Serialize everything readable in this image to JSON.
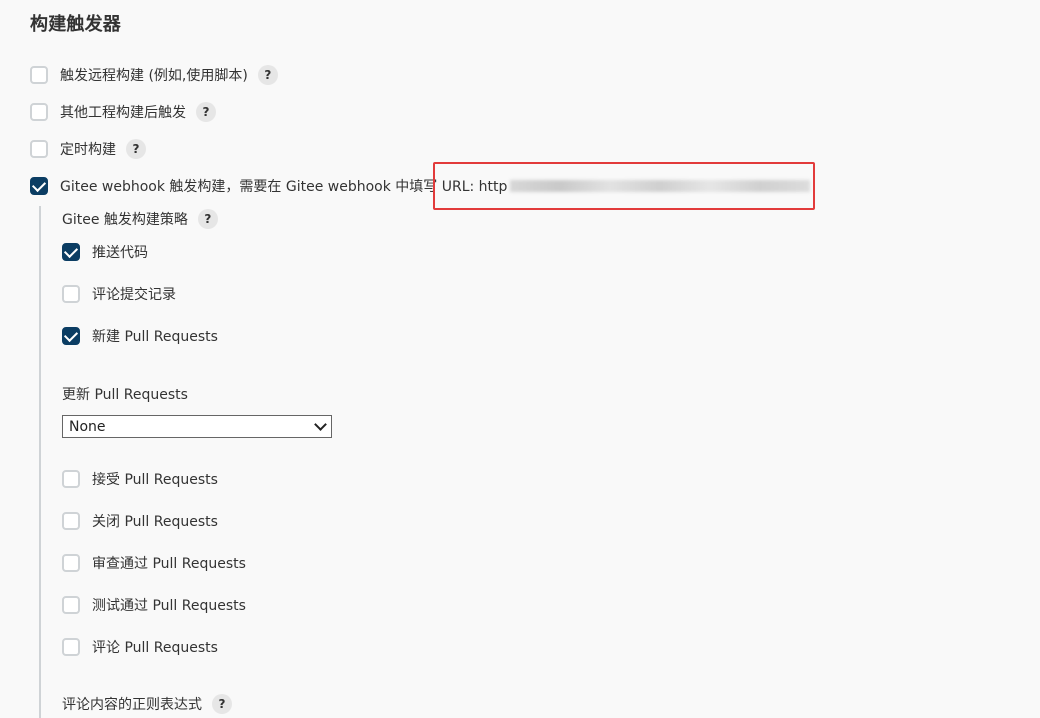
{
  "section": {
    "title": "构建触发器"
  },
  "triggers": [
    {
      "label": "触发远程构建 (例如,使用脚本)",
      "checked": false,
      "help": "?"
    },
    {
      "label": "其他工程构建后触发",
      "checked": false,
      "help": "?"
    },
    {
      "label": "定时构建",
      "checked": false,
      "help": "?"
    },
    {
      "label": "Gitee webhook 触发构建，需要在 Gitee webhook 中填写 URL: http",
      "checked": true
    }
  ],
  "gitee": {
    "strategy_title": "Gitee 触发构建策略",
    "strategy_help": "?",
    "strategies": [
      {
        "label": "推送代码",
        "checked": true
      },
      {
        "label": "评论提交记录",
        "checked": false
      },
      {
        "label": "新建 Pull Requests",
        "checked": true
      }
    ],
    "update_pr_label": "更新 Pull Requests",
    "update_pr_select_value": "None",
    "pr_actions": [
      {
        "label": "接受 Pull Requests",
        "checked": false
      },
      {
        "label": "关闭 Pull Requests",
        "checked": false
      },
      {
        "label": "审查通过 Pull Requests",
        "checked": false
      },
      {
        "label": "测试通过 Pull Requests",
        "checked": false
      },
      {
        "label": "评论 Pull Requests",
        "checked": false
      }
    ],
    "comment_regex_label": "评论内容的正则表达式",
    "comment_regex_help": "?"
  },
  "colors": {
    "checked": "#0b3d63",
    "highlight": "#e23b3b",
    "background": "#f9f9f9"
  }
}
